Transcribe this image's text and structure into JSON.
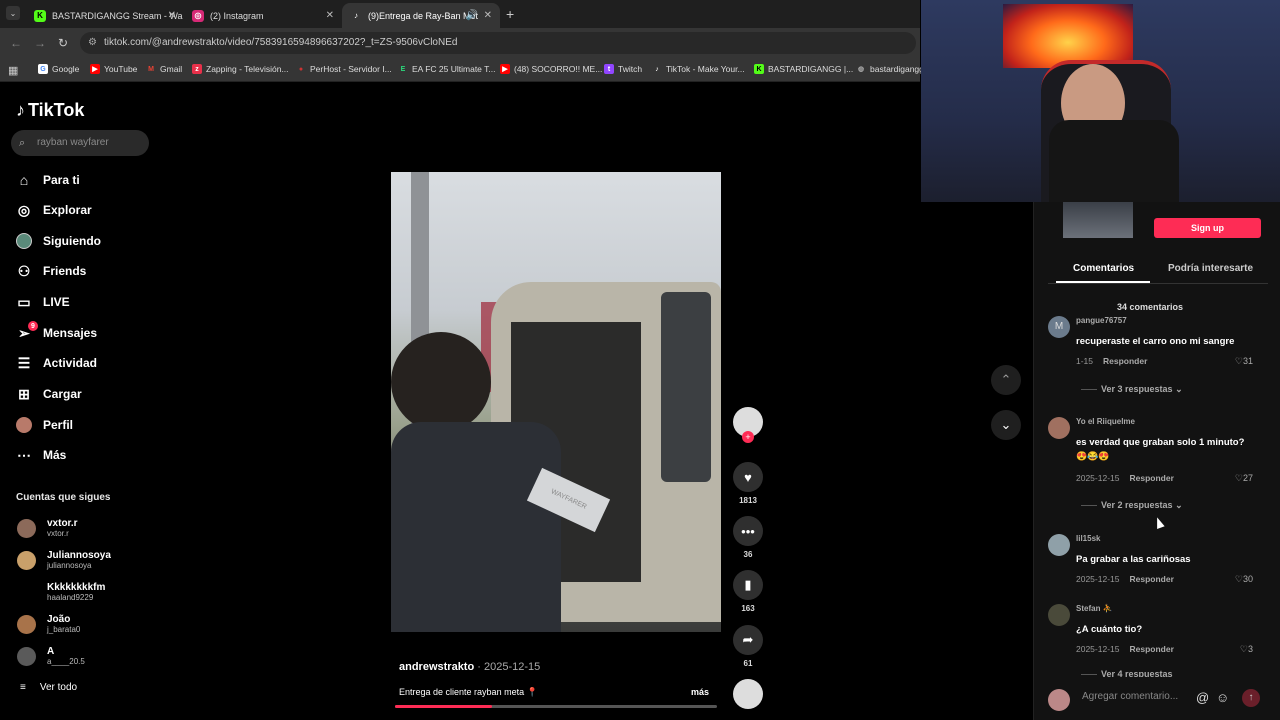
{
  "browser": {
    "tabs": [
      {
        "title": "BASTARDIGANGG Stream - Wa",
        "icon": "kick-icon",
        "color": "#53fc18"
      },
      {
        "title": "(2) Instagram",
        "icon": "instagram-icon",
        "color": "#d62976"
      },
      {
        "title": "(9)Entrega de Ray-Ban Met",
        "icon": "tiktok-icon",
        "color": "#ffffff"
      }
    ],
    "url": "tiktok.com/@andrewstrakto/video/7583916594896637202?_t=ZS-9506vCloNEd",
    "bookmarks": [
      {
        "label": "Google",
        "color": "#4285f4"
      },
      {
        "label": "YouTube",
        "color": "#ff0000"
      },
      {
        "label": "Gmail",
        "color": "#ea4335"
      },
      {
        "label": "Zapping - Televisión...",
        "color": "#e8304a"
      },
      {
        "label": "PerHost - Servidor I...",
        "color": "#cc3333"
      },
      {
        "label": "EA FC 25 Ultimate T...",
        "color": "#2bd97c"
      },
      {
        "label": "(48) SOCORRO!! ME...",
        "color": "#ff0000"
      },
      {
        "label": "Twitch",
        "color": "#9146ff"
      },
      {
        "label": "TikTok - Make Your...",
        "color": "#ffffff"
      },
      {
        "label": "BASTARDIGANGG |...",
        "color": "#53fc18"
      },
      {
        "label": "bastardigangg",
        "color": "#888888"
      }
    ]
  },
  "tiktok": {
    "brand": "TikTok",
    "search_placeholder": "rayban wayfarer",
    "nav": [
      {
        "label": "Para ti",
        "icon": "home-icon"
      },
      {
        "label": "Explorar",
        "icon": "compass-icon"
      },
      {
        "label": "Siguiendo",
        "icon": "following-avatar-icon"
      },
      {
        "label": "Friends",
        "icon": "friends-icon"
      },
      {
        "label": "LIVE",
        "icon": "live-icon"
      },
      {
        "label": "Mensajes",
        "icon": "messages-icon",
        "badge": "9"
      },
      {
        "label": "Actividad",
        "icon": "activity-icon"
      },
      {
        "label": "Cargar",
        "icon": "upload-icon"
      },
      {
        "label": "Perfil",
        "icon": "profile-avatar-icon"
      },
      {
        "label": "Más",
        "icon": "more-icon"
      }
    ],
    "following_title": "Cuentas que sigues",
    "following": [
      {
        "name": "vxtor.r",
        "handle": "vxtor.r"
      },
      {
        "name": "Juliannosoya",
        "handle": "juliannosoya"
      },
      {
        "name": "Kkkkkkkkfm",
        "handle": "haaland9229"
      },
      {
        "name": "João",
        "handle": "j_barata0"
      },
      {
        "name": "A",
        "handle": "a____20.5"
      }
    ],
    "see_all": "Ver todo"
  },
  "video": {
    "author": "andrewstrakto",
    "date": "2025-12-15",
    "caption": "Entrega de cliente rayban meta",
    "more": "más",
    "progress": 0.3,
    "box_text": "WAYFARER",
    "likes": "1813",
    "comments": "36",
    "saves": "163",
    "shares": "61"
  },
  "panel": {
    "signup": "Sign up",
    "tabs": [
      "Comentarios",
      "Podría interesarte"
    ],
    "comment_count": "34 comentarios",
    "reply_label": "Responder",
    "comments": [
      {
        "user": "pangue76757",
        "text": "recuperaste el carro ono mi sangre",
        "date": "1-15",
        "likes": "31",
        "replies": "Ver 3 respuestas",
        "avatar": "#6b7b8c",
        "initial": "M"
      },
      {
        "user": "Yo el Riiquelme",
        "text": "es verdad que graban solo 1 minuto?",
        "emoji": "😍😂😍",
        "date": "2025-12-15",
        "likes": "27",
        "replies": "Ver 2 respuestas",
        "avatar": "#a07060"
      },
      {
        "user": "lil15sk",
        "text": "Pa grabar a las cariñosas",
        "date": "2025-12-15",
        "likes": "30",
        "avatar": "#8fa0a8"
      },
      {
        "user": "Stefan ⛹",
        "text": "¿A cuánto tio?",
        "date": "2025-12-15",
        "likes": "3",
        "replies": "Ver 4 respuestas",
        "avatar": "#4a4a3a"
      }
    ],
    "add_comment_placeholder": "Agregar comentario..."
  }
}
